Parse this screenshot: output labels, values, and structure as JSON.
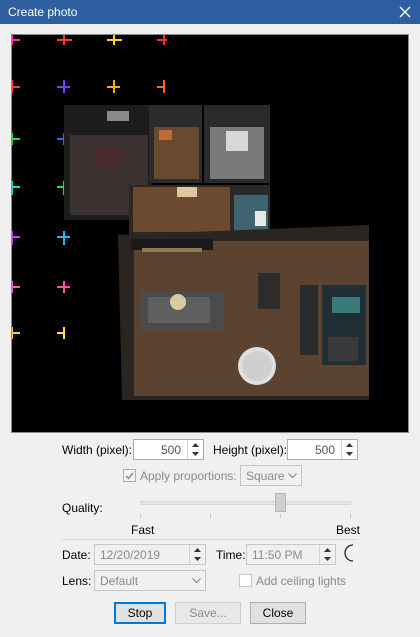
{
  "window": {
    "title": "Create photo"
  },
  "width": {
    "label": "Width (pixel):",
    "value": "500"
  },
  "height": {
    "label": "Height (pixel):",
    "value": "500"
  },
  "proportions": {
    "label": "Apply proportions:",
    "checked": true,
    "option": "Square"
  },
  "quality": {
    "label": "Quality:",
    "fast": "Fast",
    "best": "Best",
    "level": 0.67
  },
  "date": {
    "label": "Date:",
    "value": "12/20/2019"
  },
  "time": {
    "label": "Time:",
    "value": "11:50 PM"
  },
  "lens": {
    "label": "Lens:",
    "value": "Default"
  },
  "ceiling": {
    "label": "Add ceiling lights",
    "checked": false
  },
  "buttons": {
    "stop": "Stop",
    "save": "Save...",
    "close": "Close"
  },
  "icons": {
    "close": "close-icon",
    "moon": "moon-icon",
    "check": "checkmark-icon",
    "dropdown": "chevron-down-icon",
    "spin_up": "arrow-up-icon",
    "spin_down": "arrow-down-icon"
  },
  "colors": {
    "titlebar": "#2f5fa0",
    "preview_bg": "#000000",
    "default_button_border": "#0078d7"
  }
}
